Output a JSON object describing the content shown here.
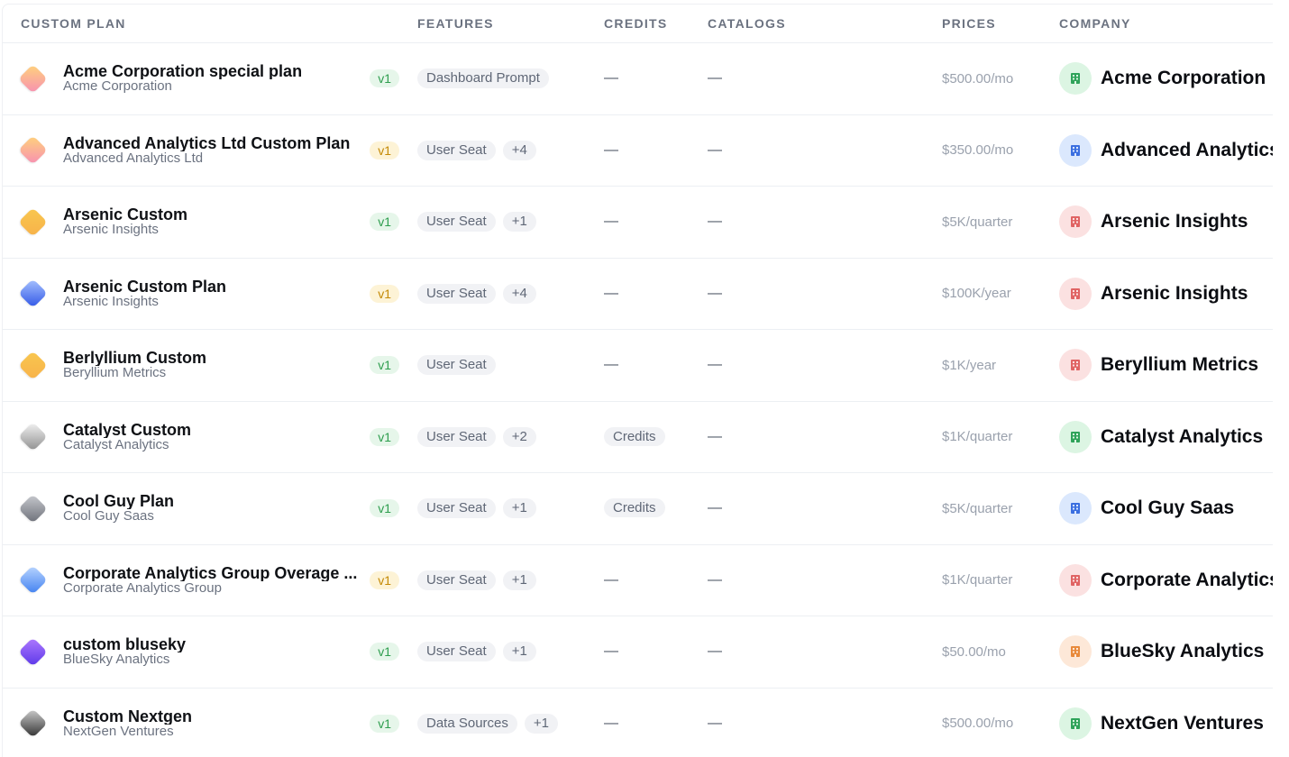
{
  "columns": {
    "plan": "CUSTOM PLAN",
    "features": "FEATURES",
    "credits": "CREDITS",
    "catalogs": "CATALOGS",
    "prices": "PRICES",
    "company": "COMPANY"
  },
  "rows": [
    {
      "icon": "plan-diamond-icon",
      "icon_gradient": [
        "#ffd37a",
        "#f78fb3"
      ],
      "name": "Acme Corporation special plan",
      "company_sub": "Acme Corporation",
      "version": "v1",
      "version_color": "green",
      "features": [
        "Dashboard Prompt"
      ],
      "credits": "—",
      "catalogs": "—",
      "price": "$500.00/mo",
      "company": "Acme Corporation",
      "avatar_bg": "#dcf5e3",
      "avatar_fg": "#2fa35a"
    },
    {
      "icon": "plan-diamond-icon",
      "icon_gradient": [
        "#ffd37a",
        "#f78fb3"
      ],
      "name": "Advanced Analytics Ltd Custom Plan",
      "company_sub": "Advanced Analytics Ltd",
      "version": "v1",
      "version_color": "yellow",
      "features": [
        "User Seat",
        "+4"
      ],
      "credits": "—",
      "catalogs": "—",
      "price": "$350.00/mo",
      "company": "Advanced Analytics Ltd",
      "avatar_bg": "#dbe8fd",
      "avatar_fg": "#3b6fe0"
    },
    {
      "icon": "plan-diamond-icon",
      "icon_gradient": [
        "#f9c74f",
        "#f7b24a"
      ],
      "name": "Arsenic Custom",
      "company_sub": "Arsenic Insights",
      "version": "v1",
      "version_color": "green",
      "features": [
        "User Seat",
        "+1"
      ],
      "credits": "—",
      "catalogs": "—",
      "price": "$5K/quarter",
      "company": "Arsenic Insights",
      "avatar_bg": "#fbe1e1",
      "avatar_fg": "#e06464"
    },
    {
      "icon": "plan-diamond-icon",
      "icon_gradient": [
        "#a9c4ff",
        "#2f55e6"
      ],
      "name": "Arsenic Custom Plan",
      "company_sub": "Arsenic Insights",
      "version": "v1",
      "version_color": "yellow",
      "features": [
        "User Seat",
        "+4"
      ],
      "credits": "—",
      "catalogs": "—",
      "price": "$100K/year",
      "company": "Arsenic Insights",
      "avatar_bg": "#fbe1e1",
      "avatar_fg": "#e06464"
    },
    {
      "icon": "plan-diamond-icon",
      "icon_gradient": [
        "#f9c74f",
        "#f7b24a"
      ],
      "name": "Berlyllium Custom",
      "company_sub": "Beryllium Metrics",
      "version": "v1",
      "version_color": "green",
      "features": [
        "User Seat"
      ],
      "credits": "—",
      "catalogs": "—",
      "price": "$1K/year",
      "company": "Beryllium Metrics",
      "avatar_bg": "#fbe1e1",
      "avatar_fg": "#e06464"
    },
    {
      "icon": "plan-diamond-icon",
      "icon_gradient": [
        "#f4f4f4",
        "#8d8d8d"
      ],
      "name": "Catalyst Custom",
      "company_sub": "Catalyst Analytics",
      "version": "v1",
      "version_color": "green",
      "features": [
        "User Seat",
        "+2"
      ],
      "credits": "Credits",
      "catalogs": "—",
      "price": "$1K/quarter",
      "company": "Catalyst Analytics",
      "avatar_bg": "#dcf5e3",
      "avatar_fg": "#2fa35a"
    },
    {
      "icon": "plan-diamond-icon",
      "icon_gradient": [
        "#c9cbd0",
        "#6b6e77"
      ],
      "name": "Cool Guy Plan",
      "company_sub": "Cool Guy Saas",
      "version": "v1",
      "version_color": "green",
      "features": [
        "User Seat",
        "+1"
      ],
      "credits": "Credits",
      "catalogs": "—",
      "price": "$5K/quarter",
      "company": "Cool Guy Saas",
      "avatar_bg": "#dbe8fd",
      "avatar_fg": "#3b6fe0"
    },
    {
      "icon": "plan-diamond-icon",
      "icon_gradient": [
        "#bcd7ff",
        "#3f7ff0"
      ],
      "name": "Corporate Analytics Group Overage ...",
      "company_sub": "Corporate Analytics Group",
      "version": "v1",
      "version_color": "yellow",
      "features": [
        "User Seat",
        "+1"
      ],
      "credits": "—",
      "catalogs": "—",
      "price": "$1K/quarter",
      "company": "Corporate Analytics Group",
      "avatar_bg": "#fbe1e1",
      "avatar_fg": "#e06464"
    },
    {
      "icon": "plan-diamond-icon",
      "icon_gradient": [
        "#b07bff",
        "#5a36e8"
      ],
      "name": "custom bluseky",
      "company_sub": "BlueSky Analytics",
      "version": "v1",
      "version_color": "green",
      "features": [
        "User Seat",
        "+1"
      ],
      "credits": "—",
      "catalogs": "—",
      "price": "$50.00/mo",
      "company": "BlueSky Analytics",
      "avatar_bg": "#fde8d8",
      "avatar_fg": "#e88a3c"
    },
    {
      "icon": "plan-diamond-icon",
      "icon_gradient": [
        "#d0d0d0",
        "#2e2e2e"
      ],
      "name": "Custom Nextgen",
      "company_sub": "NextGen Ventures",
      "version": "v1",
      "version_color": "green",
      "features": [
        "Data Sources",
        "+1"
      ],
      "credits": "—",
      "catalogs": "—",
      "price": "$500.00/mo",
      "company": "NextGen Ventures",
      "avatar_bg": "#dcf5e3",
      "avatar_fg": "#2fa35a"
    }
  ],
  "building_icon": "building-icon"
}
